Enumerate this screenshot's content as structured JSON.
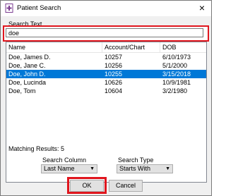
{
  "window": {
    "title": "Patient Search"
  },
  "search": {
    "label": "Search Text",
    "value": "doe"
  },
  "list": {
    "columns": [
      "Name",
      "Account/Chart",
      "DOB"
    ],
    "rows": [
      {
        "name": "Doe, James D.",
        "account": "10257",
        "dob": "6/10/1973",
        "selected": false
      },
      {
        "name": "Doe, Jane C.",
        "account": "10256",
        "dob": "5/1/2000",
        "selected": false
      },
      {
        "name": "Doe, John D.",
        "account": "10255",
        "dob": "3/15/2018",
        "selected": true
      },
      {
        "name": "Doe, Lucinda",
        "account": "10626",
        "dob": "10/9/1981",
        "selected": false
      },
      {
        "name": "Doe, Tom",
        "account": "10604",
        "dob": "3/2/1980",
        "selected": false
      }
    ]
  },
  "results": {
    "text": "Matching Results: 5"
  },
  "search_column": {
    "label": "Search Column",
    "value": "Last Name"
  },
  "search_type": {
    "label": "Search Type",
    "value": "Starts With"
  },
  "buttons": {
    "ok": "OK",
    "cancel": "Cancel"
  },
  "colors": {
    "highlight": "#e0161e",
    "selection": "#0078d7"
  }
}
